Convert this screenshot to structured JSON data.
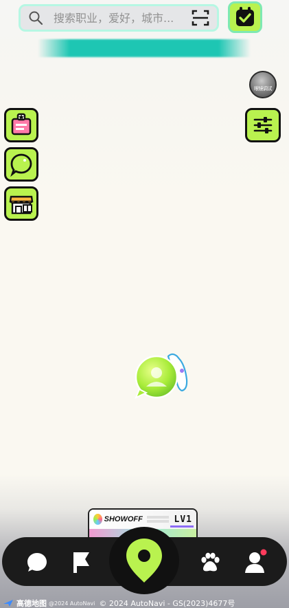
{
  "search": {
    "placeholder": "搜索职业，爱好，城市...",
    "value": ""
  },
  "map_view_toggle": {
    "label": "眼镜调试"
  },
  "profile_card": {
    "brand": "SHOWOFF",
    "level": "LV1"
  },
  "attribution": {
    "provider": "高德地图",
    "copyright": "@2024 AutoNavi",
    "license": "© 2024 AutoNavi - GS(2023)4677号"
  },
  "icons": {
    "search": "search-icon",
    "scan": "scan-icon",
    "checkin": "check-calendar-icon",
    "view_toggle": "glasses-view-icon",
    "badge": "id-badge-icon",
    "chat_bubble": "chat-bubble-icon",
    "shop": "shop-icon",
    "filter": "filter-sliders-icon",
    "nav_messages": "message-icon",
    "nav_flags": "flag-icon",
    "nav_map": "map-pin-icon",
    "nav_pets": "paw-icon",
    "nav_profile": "user-icon"
  },
  "colors": {
    "accent_lime": "#b9f24f",
    "accent_teal": "#1ec6b3",
    "nav_dark": "#1b1b1b",
    "notification_dot": "#ff3b5c"
  }
}
